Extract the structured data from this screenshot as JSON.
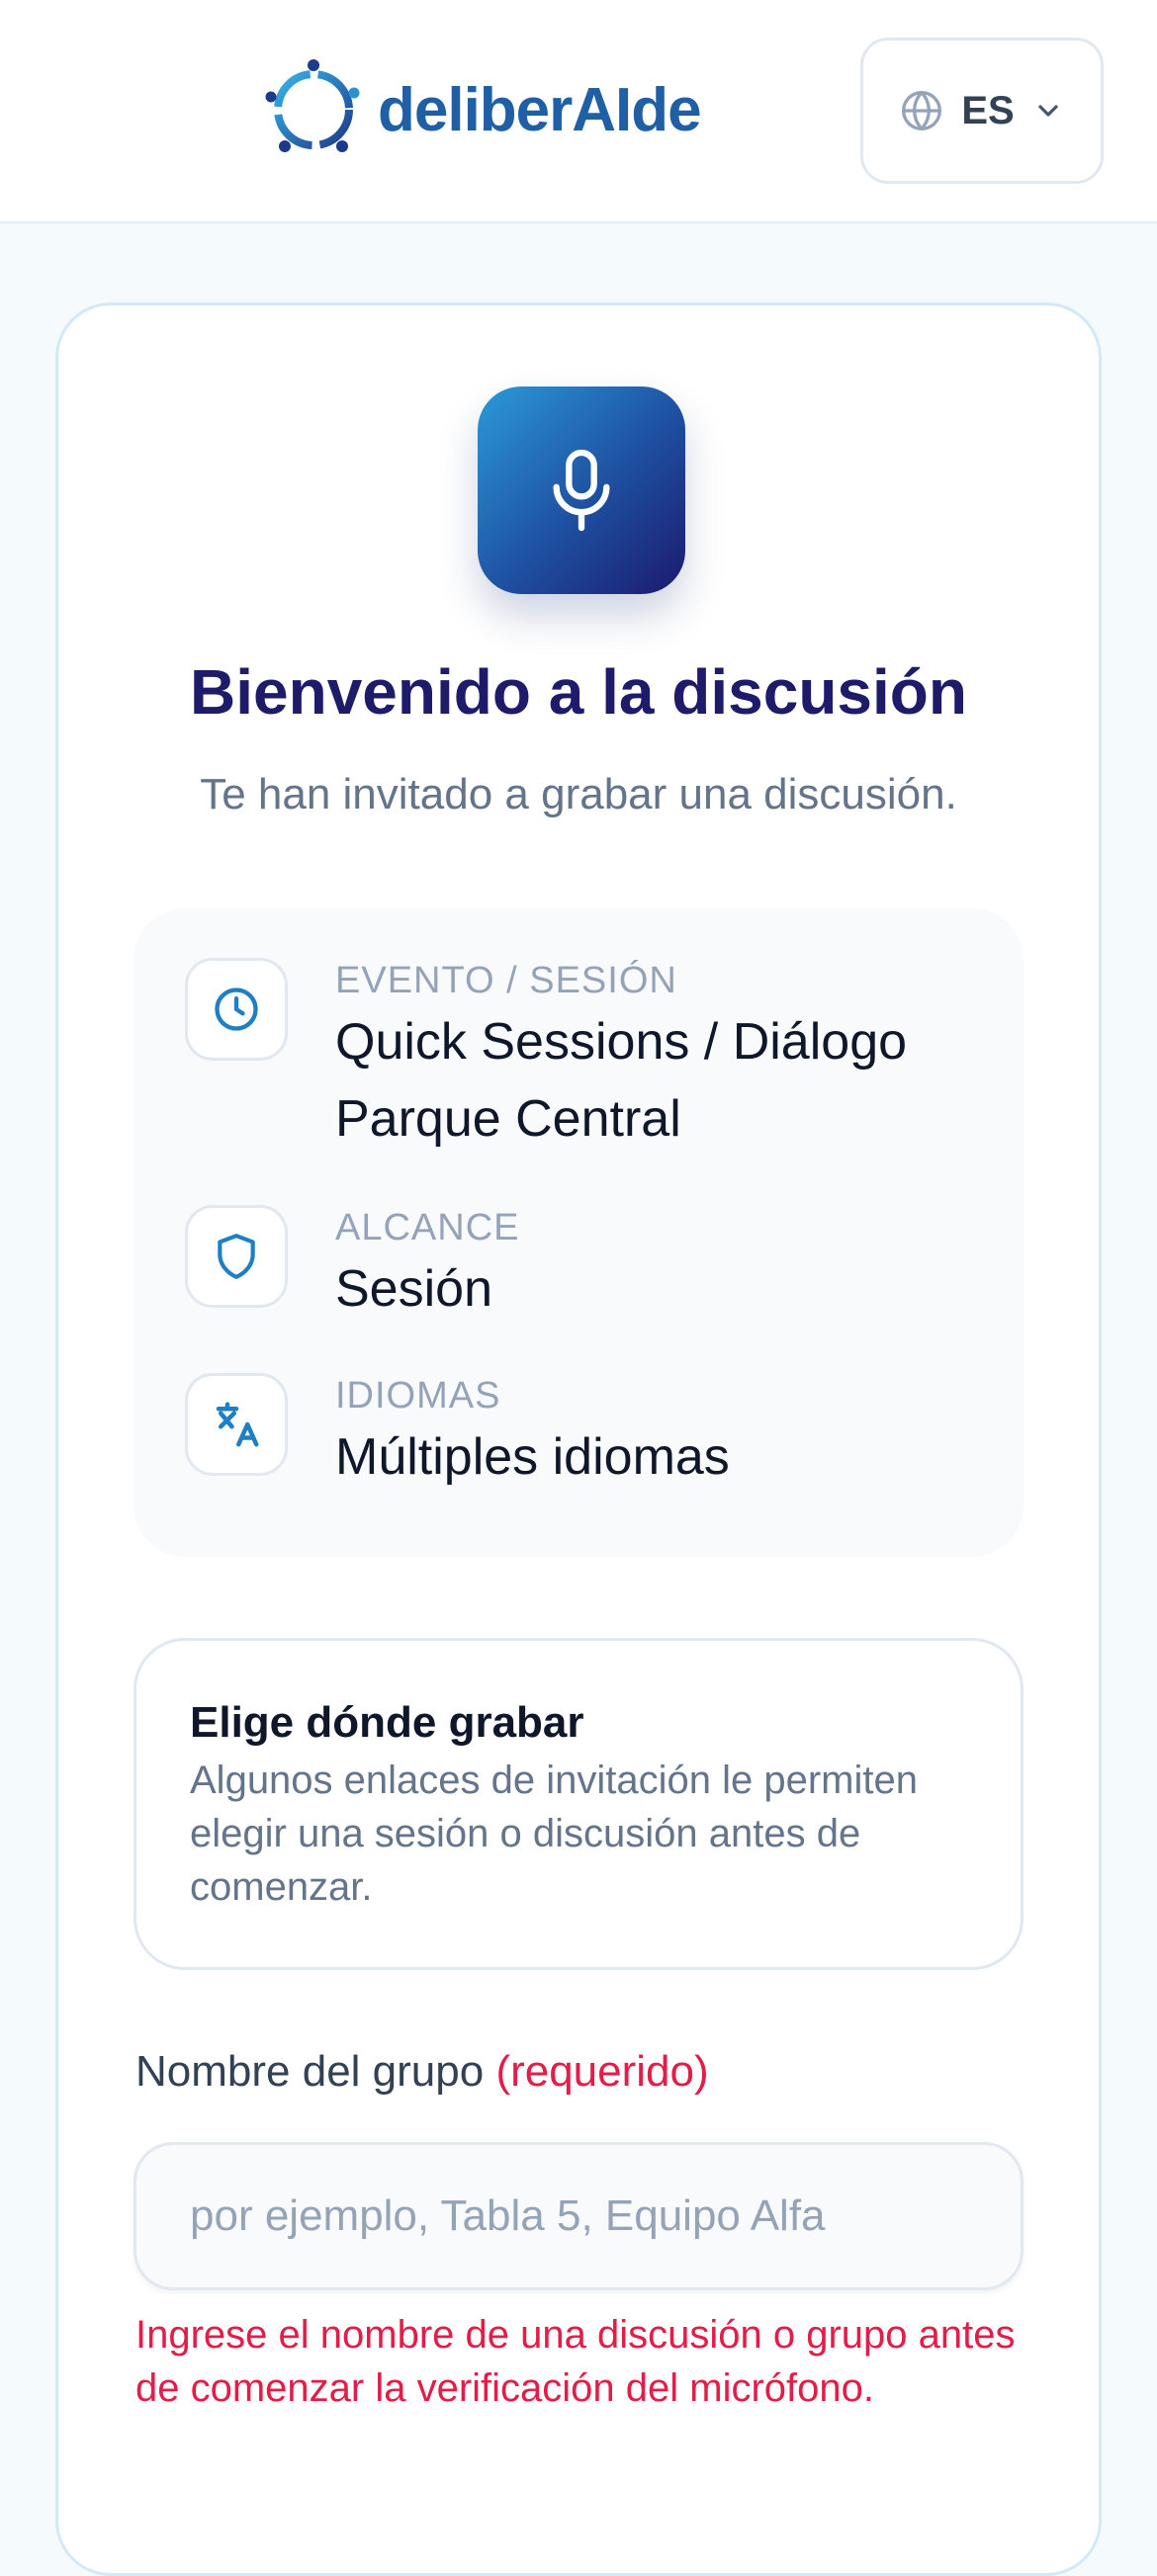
{
  "header": {
    "brand": "deliberAIde",
    "language": "ES"
  },
  "welcome": {
    "title": "Bienvenido a la discusión",
    "subtitle": "Te han invitado a grabar una discusión."
  },
  "info": {
    "items": [
      {
        "icon": "clock-icon",
        "label": "EVENTO / SESIÓN",
        "value": "Quick Sessions / Diálogo Parque Central"
      },
      {
        "icon": "shield-icon",
        "label": "ALCANCE",
        "value": "Sesión"
      },
      {
        "icon": "translate-icon",
        "label": "IDIOMAS",
        "value": "Múltiples idiomas"
      }
    ]
  },
  "choose": {
    "title": "Elige dónde grabar",
    "description": "Algunos enlaces de invitación le permiten elegir una sesión o discusión antes de comenzar."
  },
  "group_field": {
    "label": "Nombre del grupo",
    "required_label": "(requerido)",
    "placeholder": "por ejemplo, Tabla 5, Equipo Alfa",
    "value": "",
    "error": "Ingrese el nombre de una discusión o grupo antes de comenzar la verificación del micrófono."
  },
  "colors": {
    "brand": "#1f5fa6",
    "title": "#1e1b6b",
    "accent": "#1f7fc4",
    "error": "#e11d48"
  }
}
